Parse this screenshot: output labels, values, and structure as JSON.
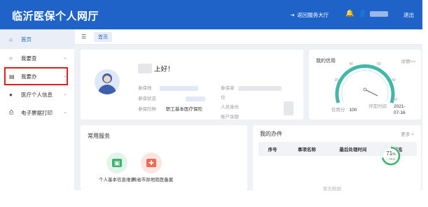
{
  "header": {
    "title": "临沂医保个人网厅",
    "back_label": "返回服务大厅",
    "logout_label": "退出"
  },
  "sidebar": {
    "items": [
      {
        "label": "首页",
        "icon": "home-icon"
      },
      {
        "label": "我要查",
        "icon": "search-icon"
      },
      {
        "label": "我要办",
        "icon": "folder-icon"
      },
      {
        "label": "医疗个人信息",
        "icon": "person-icon"
      },
      {
        "label": "电子票据打印",
        "icon": "printer-icon"
      }
    ]
  },
  "tabbar": {
    "active_tab": "首页"
  },
  "profile": {
    "greeting": "上好！",
    "left_labels": [
      "参保地",
      "参保状态",
      "参保险种"
    ],
    "insurance_type": "职工基本医疗保险",
    "right_labels": [
      "参保单",
      "位",
      "人员身份",
      "账户余额"
    ]
  },
  "credit": {
    "title": "我的信用",
    "more": "详情>>",
    "gauge_ticks": [
      "0",
      "20",
      "40",
      "60",
      "80",
      "100"
    ],
    "score_label": "信用分",
    "score": "100",
    "eval_time_label": "评定时间",
    "eval_time": "2021-07-16",
    "gauge_value": 100
  },
  "services": {
    "title": "常用服务",
    "items": [
      {
        "label": "个人基本信息维护",
        "color": "#3bb36b"
      },
      {
        "label": "跨省市异地就医备案",
        "color": "#f06a4f"
      }
    ]
  },
  "tasks": {
    "title": "我的办件",
    "more": "更多 >",
    "columns": [
      "序号",
      "事项名称",
      "最后处理时间",
      "状态"
    ],
    "empty_text": "暂无数据",
    "progress_value": 71,
    "progress_unit": "%",
    "progress_sub": "↓ 0K/s"
  },
  "colors": {
    "brand": "#1f63c9",
    "highlight": "#e02020",
    "gauge": "#3fb8a8"
  }
}
